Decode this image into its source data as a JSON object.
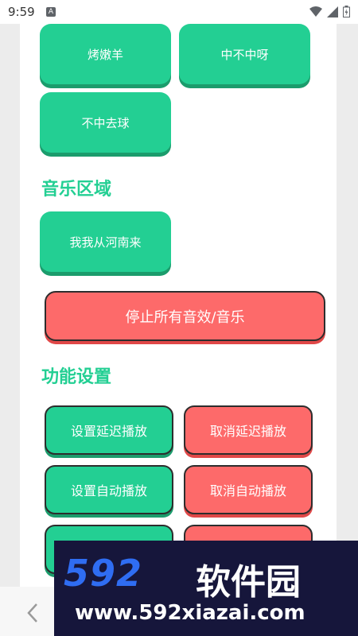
{
  "status_bar": {
    "time": "9:59",
    "notification_badge": "A",
    "icons": [
      "wifi-icon",
      "signal-icon",
      "battery-icon"
    ]
  },
  "sound_buttons_top": [
    {
      "label": "烤嫩羊"
    },
    {
      "label": "中不中呀"
    },
    {
      "label": "不中去球"
    }
  ],
  "music_section": {
    "title": "音乐区域",
    "items": [
      {
        "label": "我我从河南来"
      }
    ]
  },
  "stop_button": {
    "label": "停止所有音效/音乐"
  },
  "settings_section": {
    "title": "功能设置",
    "buttons": [
      {
        "label": "设置延迟播放",
        "color": "#23cf93"
      },
      {
        "label": "取消延迟播放",
        "color": "#fd6a6a"
      },
      {
        "label": "设置自动播放",
        "color": "#23cf93"
      },
      {
        "label": "取消自动播放",
        "color": "#fd6a6a"
      }
    ]
  },
  "watermark": {
    "brand_number": "592",
    "brand_cn": "软件园",
    "url": "www.592xiazai.com"
  },
  "colors": {
    "accent_green": "#23cf93",
    "accent_red": "#fd6a6a",
    "watermark_bg": "#16163b",
    "watermark_blue": "#2f6df2"
  }
}
